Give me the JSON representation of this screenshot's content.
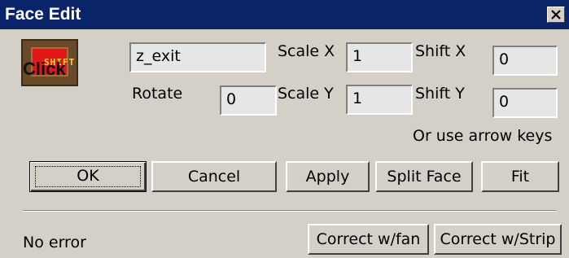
{
  "window": {
    "title": "Face Edit"
  },
  "texture_thumbnail": {
    "overlay_text": "Click",
    "inner_text": "SHIFT"
  },
  "fields": {
    "texture_name": "z_exit",
    "scale_x": "1",
    "scale_y": "1",
    "shift_x": "0",
    "shift_y": "0",
    "rotate": "0"
  },
  "labels": {
    "scale_x": "Scale X",
    "scale_y": "Scale Y",
    "shift_x": "Shift X",
    "shift_y": "Shift Y",
    "rotate": "Rotate",
    "hint": "Or use arrow keys"
  },
  "buttons": {
    "ok": "OK",
    "cancel": "Cancel",
    "apply": "Apply",
    "split_face": "Split Face",
    "fit": "Fit",
    "correct_fan": "Correct w/fan",
    "correct_strip": "Correct w/Strip"
  },
  "status": {
    "text": "No error"
  },
  "colors": {
    "titlebar": "#0a246a",
    "dialog_bg": "#d4d0c8",
    "field_bg": "#e6e6e6"
  }
}
